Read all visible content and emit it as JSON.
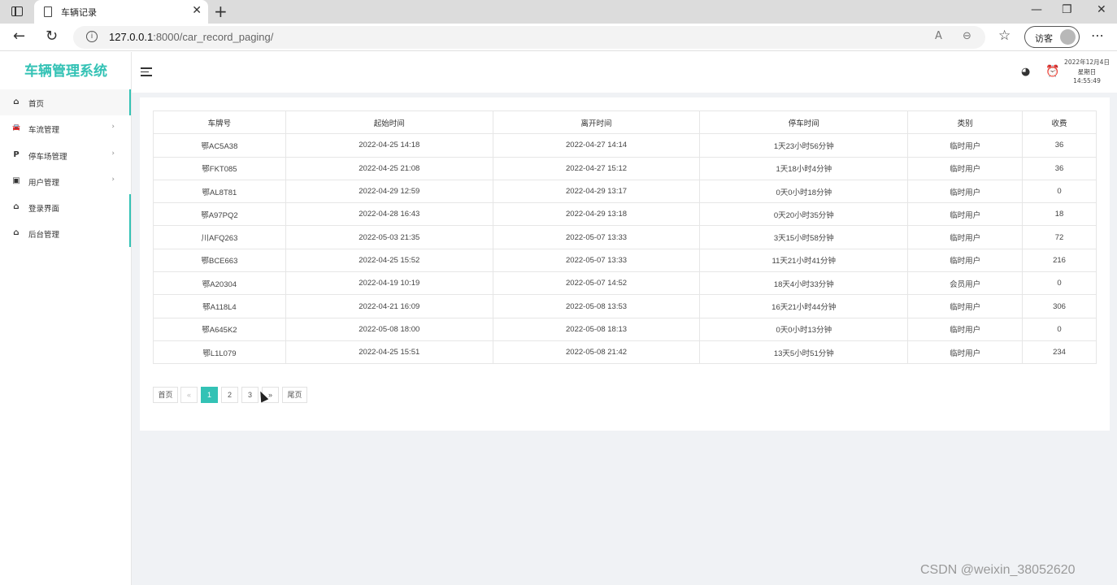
{
  "browser": {
    "tab_title": "车辆记录",
    "tab_close": "✕",
    "new_tab": "+",
    "url_host": "127.0.0.1",
    "url_rest": ":8000/car_record_paging/",
    "profile_label": "访客",
    "win_min": "—",
    "win_restore": "❐",
    "win_close": "✕"
  },
  "sidebar": {
    "brand": "车辆管理系统",
    "items": [
      {
        "label": "首页",
        "icon": "home-icon",
        "glyph": "⌂",
        "arrow": ""
      },
      {
        "label": "车流管理",
        "icon": "car-icon",
        "glyph": "🚘",
        "arrow": "›"
      },
      {
        "label": "停车场管理",
        "icon": "parking-icon",
        "glyph": "P",
        "arrow": "›"
      },
      {
        "label": "用户管理",
        "icon": "user-card-icon",
        "glyph": "▣",
        "arrow": "›"
      },
      {
        "label": "登录界面",
        "icon": "home-icon",
        "glyph": "⌂",
        "arrow": ""
      },
      {
        "label": "后台管理",
        "icon": "home-icon",
        "glyph": "⌂",
        "arrow": ""
      }
    ]
  },
  "header": {
    "date": "2022年12月4日",
    "weekday": "星期日",
    "time": "14:55:49"
  },
  "table": {
    "columns": [
      "车牌号",
      "起始时间",
      "离开时间",
      "停车时间",
      "类别",
      "收费"
    ],
    "rows": [
      [
        "鄂AC5A38",
        "2022-04-25 14:18",
        "2022-04-27 14:14",
        "1天23小时56分钟",
        "临时用户",
        "36"
      ],
      [
        "鄂FKT085",
        "2022-04-25 21:08",
        "2022-04-27 15:12",
        "1天18小时4分钟",
        "临时用户",
        "36"
      ],
      [
        "鄂AL8T81",
        "2022-04-29 12:59",
        "2022-04-29 13:17",
        "0天0小时18分钟",
        "临时用户",
        "0"
      ],
      [
        "鄂A97PQ2",
        "2022-04-28 16:43",
        "2022-04-29 13:18",
        "0天20小时35分钟",
        "临时用户",
        "18"
      ],
      [
        "川AFQ263",
        "2022-05-03 21:35",
        "2022-05-07 13:33",
        "3天15小时58分钟",
        "临时用户",
        "72"
      ],
      [
        "鄂BCE663",
        "2022-04-25 15:52",
        "2022-05-07 13:33",
        "11天21小时41分钟",
        "临时用户",
        "216"
      ],
      [
        "鄂A20304",
        "2022-04-19 10:19",
        "2022-05-07 14:52",
        "18天4小时33分钟",
        "会员用户",
        "0"
      ],
      [
        "鄂A118L4",
        "2022-04-21 16:09",
        "2022-05-08 13:53",
        "16天21小时44分钟",
        "临时用户",
        "306"
      ],
      [
        "鄂A645K2",
        "2022-05-08 18:00",
        "2022-05-08 18:13",
        "0天0小时13分钟",
        "临时用户",
        "0"
      ],
      [
        "鄂L1L079",
        "2022-04-25 15:51",
        "2022-05-08 21:42",
        "13天5小时51分钟",
        "临时用户",
        "234"
      ]
    ]
  },
  "pager": {
    "first": "首页",
    "prev": "«",
    "pages": [
      "1",
      "2",
      "3"
    ],
    "current": "1",
    "next": "»",
    "last": "尾页"
  },
  "watermark": "CSDN @weixin_38052620",
  "colors": {
    "accent": "#33c2b5",
    "content_bg": "#f0f2f5"
  }
}
